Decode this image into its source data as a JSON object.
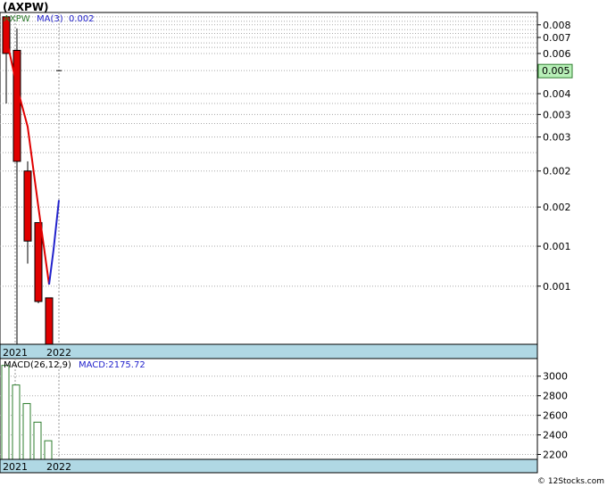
{
  "chart_data": [
    {
      "type": "candlestick",
      "title": "(AXPW)",
      "legend": {
        "symbol": "AXPW",
        "ma_label": "MA(3)",
        "ma_value": "0.002"
      },
      "scale": "log",
      "ylim": [
        0.00036,
        0.0096
      ],
      "y_ticks": [
        {
          "value": 0.0085,
          "label": "0.008"
        },
        {
          "value": 0.0075,
          "label": "0.007"
        },
        {
          "value": 0.0064,
          "label": "0.006"
        },
        {
          "value": 0.0043,
          "label": "0.004"
        },
        {
          "value": 0.0035,
          "label": "0.003"
        },
        {
          "value": 0.0028,
          "label": "0.003"
        },
        {
          "value": 0.002,
          "label": "0.002"
        },
        {
          "value": 0.0014,
          "label": "0.002"
        },
        {
          "value": 0.00095,
          "label": "0.001"
        },
        {
          "value": 0.00064,
          "label": "0.001"
        }
      ],
      "gridlines": [
        0.0092,
        0.0088,
        0.0085,
        0.0081,
        0.0078,
        0.0075,
        0.0071,
        0.0068,
        0.0064,
        0.0054,
        0.0043,
        0.0039,
        0.0035,
        0.0032,
        0.0028,
        0.0024,
        0.002,
        0.0014,
        0.00095,
        0.00064
      ],
      "current_price": {
        "value": 0.0054,
        "label": "0.005"
      },
      "x_labels": [
        "2021",
        "2022"
      ],
      "candles": [
        {
          "high": 0.0092,
          "low": 0.0039,
          "open": 0.0092,
          "close": 0.0064
        },
        {
          "high": 0.0082,
          "low": 0.00036,
          "open": 0.0066,
          "close": 0.0022
        },
        {
          "high": 0.0022,
          "low": 0.0008,
          "open": 0.002,
          "close": 0.001
        },
        {
          "high": 0.0012,
          "low": 0.00054,
          "open": 0.0012,
          "close": 0.00055
        },
        {
          "high": 0.00057,
          "low": 0.00036,
          "open": 0.00057,
          "close": 0.00036
        },
        {
          "high": null,
          "low": null,
          "open": 0.0054,
          "close": 0.0054
        }
      ],
      "ma_series": {
        "red": [
          0.0075,
          0.0046,
          0.0031,
          0.0014,
          0.00065
        ],
        "blue": [
          0.00065,
          0.00092,
          0.0015
        ]
      }
    },
    {
      "type": "bar",
      "title": "MACD(26,12,9)",
      "value_label": "MACD:2175.72",
      "ylim": [
        2150,
        3180
      ],
      "y_ticks": [
        3000,
        2800,
        2600,
        2400,
        2200
      ],
      "values": [
        3110,
        2910,
        2720,
        2530,
        2340
      ],
      "x_labels": [
        "2021",
        "2022"
      ]
    }
  ],
  "footer": {
    "copyright": "© 12Stocks.com"
  },
  "colors": {
    "up": "#ffffff",
    "down": "#e00000",
    "ma_red": "#e00000",
    "ma_blue": "#2222cc",
    "axis_band": "#b0d8e4",
    "price_tag": "#b8f0b8",
    "macd_bar": "#2e7d2e",
    "grid": "#a8a8a8"
  }
}
